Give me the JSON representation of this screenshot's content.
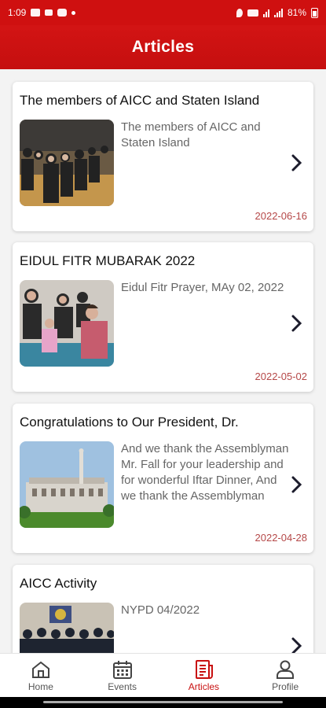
{
  "status_bar": {
    "time": "1:09",
    "battery": "81%"
  },
  "header": {
    "title": "Articles"
  },
  "articles": [
    {
      "title": "The members of AICC and Staten Island",
      "excerpt": "The members of AICC and Staten Island",
      "date": "2022-06-16"
    },
    {
      "title": "EIDUL FITR MUBARAK 2022",
      "excerpt": "Eidul Fitr Prayer, MAy 02, 2022",
      "date": "2022-05-02"
    },
    {
      "title": "Congratulations to Our President, Dr.",
      "excerpt": "And we thank the Assemblyman Mr. Fall for your leadership and for wonderful Iftar Dinner,  And we thank the Assemblyman",
      "date": "2022-04-28"
    },
    {
      "title": "AICC Activity",
      "excerpt": "NYPD 04/2022",
      "date": ""
    }
  ],
  "bottom_nav": [
    {
      "label": "Home",
      "icon": "home-icon",
      "active": false
    },
    {
      "label": "Events",
      "icon": "calendar-icon",
      "active": false
    },
    {
      "label": "Articles",
      "icon": "articles-icon",
      "active": true
    },
    {
      "label": "Profile",
      "icon": "profile-icon",
      "active": false
    }
  ],
  "colors": {
    "primary": "#cf1010",
    "date": "#b54848",
    "active_nav": "#c81010"
  }
}
